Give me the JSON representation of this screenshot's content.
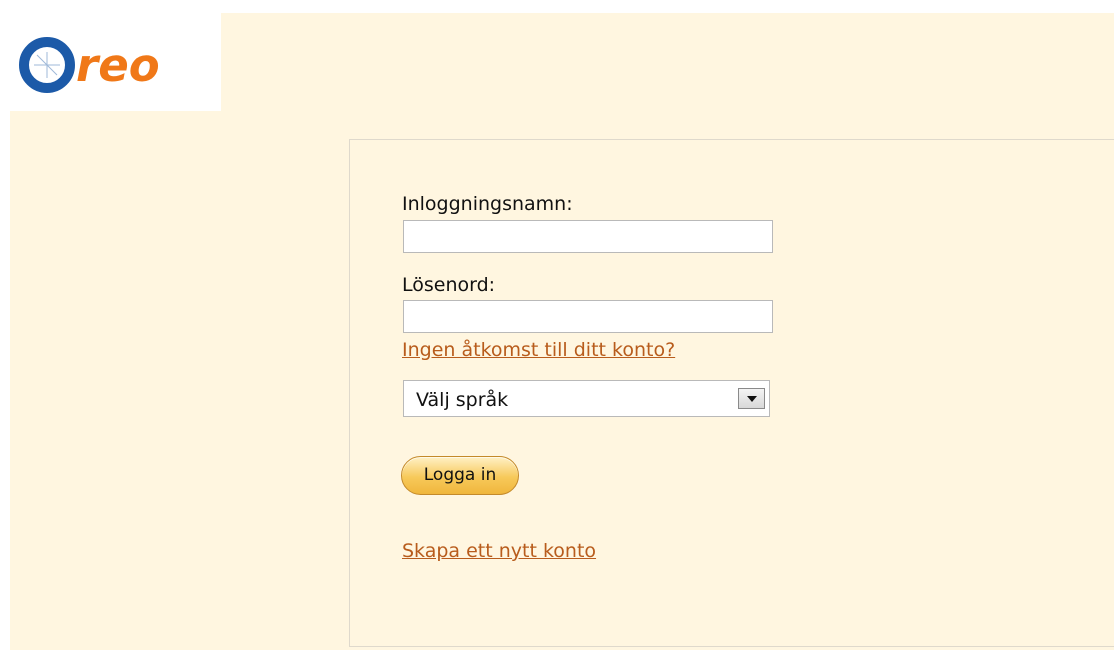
{
  "logo": {
    "text": "reo",
    "brand_color": "#f07818",
    "ring_color": "#1c5aa8"
  },
  "login_form": {
    "username_label": "Inloggningsnamn:",
    "username_value": "",
    "password_label": "Lösenord:",
    "password_value": "",
    "forgot_link": "Ingen åtkomst till ditt konto?",
    "language_select": {
      "selected": "Välj språk"
    },
    "login_button": "Logga in",
    "create_account_link": "Skapa ett nytt konto"
  },
  "colors": {
    "page_background": "#fff6e0",
    "link": "#b85c1c",
    "button": "#f7c95a"
  }
}
